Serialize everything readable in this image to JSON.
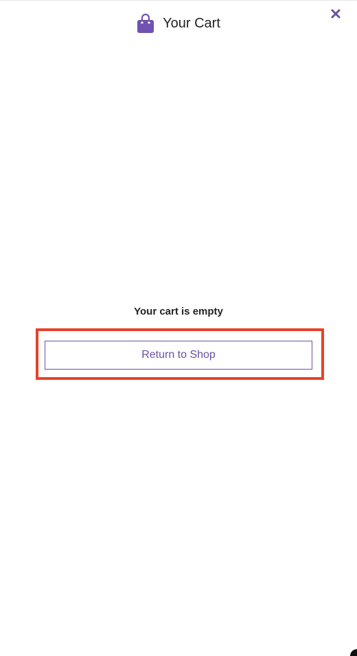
{
  "header": {
    "title": "Your Cart",
    "icon": "shopping-bag-icon",
    "close_icon": "close-icon"
  },
  "cart": {
    "empty_message": "Your cart is empty",
    "return_button_label": "Return to Shop"
  },
  "colors": {
    "accent": "#6a4fa3",
    "highlight": "#e8412a",
    "text": "#222222"
  }
}
